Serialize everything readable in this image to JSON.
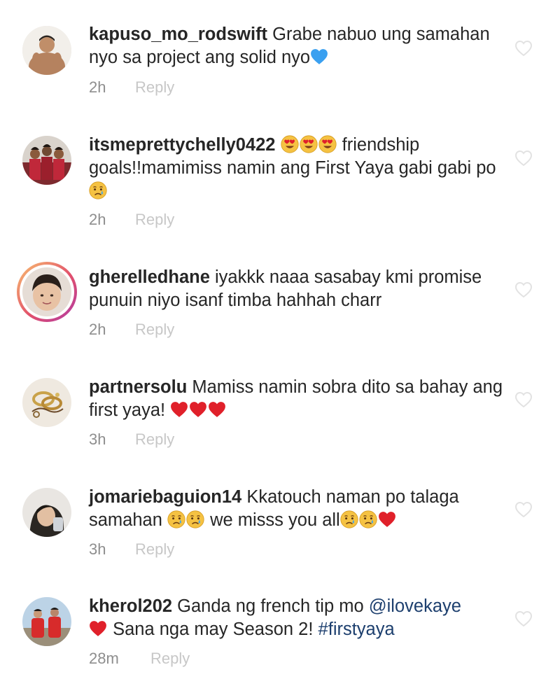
{
  "comments": [
    {
      "username": "kapuso_mo_rodswift",
      "text_1": " Grabe nabuo ung samahan nyo sa project ang solid nyo",
      "time": "2h",
      "reply_label": "Reply"
    },
    {
      "username": "itsmeprettychelly0422",
      "text_1": " friendship goals!!mamimiss namin ang First Yaya gabi gabi po",
      "time": "2h",
      "reply_label": "Reply"
    },
    {
      "username": "gherelledhane",
      "text_1": " iyakkk naaa sasabay kmi promise punuin niyo isanf timba hahhah charr",
      "time": "2h",
      "reply_label": "Reply"
    },
    {
      "username": "partnersolu",
      "text_1": " Mamiss namin sobra dito sa bahay ang first yaya! ",
      "time": "3h",
      "reply_label": "Reply"
    },
    {
      "username": "jomariebaguion14",
      "text_1": " Kkatouch naman po talaga samahan ",
      "text_2": " we misss you all",
      "time": "3h",
      "reply_label": "Reply"
    },
    {
      "username": "kherol202",
      "text_1": " Ganda ng french tip mo ",
      "mention": "@ilovekaye",
      "text_2": " Sana nga may Season 2! ",
      "hashtag": "#firstyaya",
      "time": "28m",
      "reply_label": "Reply"
    }
  ],
  "colors": {
    "username": "#262626",
    "text": "#262626",
    "link": "#1d3f6e",
    "time": "#8e8e8e",
    "reply": "#c7c7c7",
    "heart_red": "#e0202a",
    "heart_blue": "#3aa0f0",
    "emoji_yellow": "#f5c242"
  },
  "icons": {
    "blue_heart": "blue-heart-emoji",
    "red_heart": "red-heart-emoji",
    "heart_eyes": "heart-eyes-emoji",
    "crying_face": "crying-face-emoji",
    "like": "heart-outline-icon"
  }
}
